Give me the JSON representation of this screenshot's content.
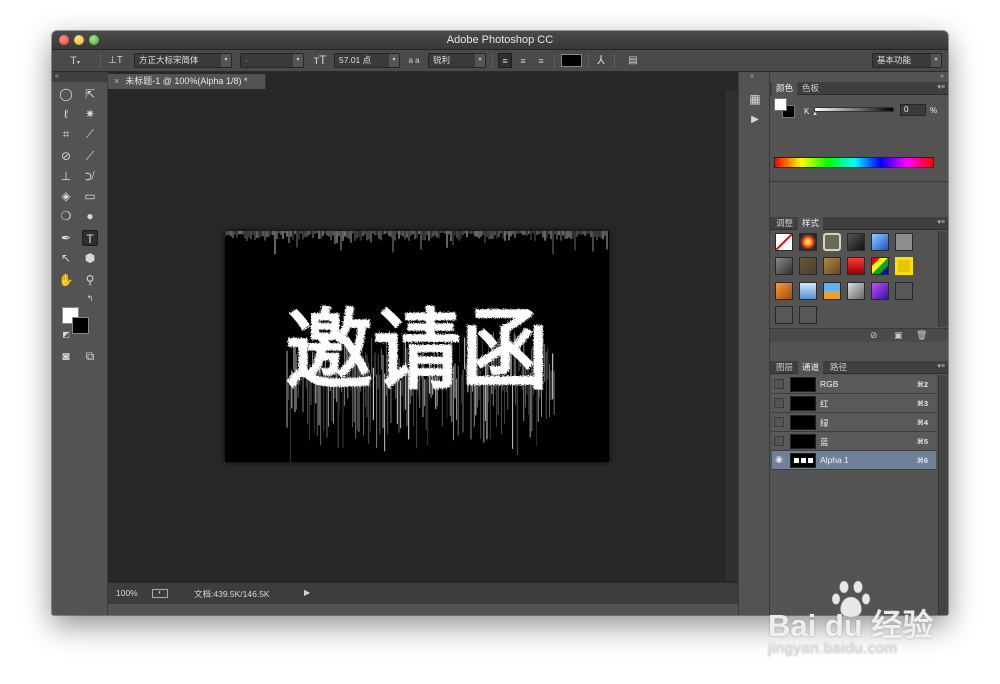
{
  "window": {
    "title": "Adobe Photoshop CC"
  },
  "options_bar": {
    "font_family": "方正大标宋简体",
    "font_style": "-",
    "font_size": "57.01 点",
    "aa_label": "a a",
    "antialias": "锐利",
    "workspace": "基本功能",
    "text_color": "#000000"
  },
  "document": {
    "tab_title": "未标题-1 @ 100%(Alpha 1/8) *",
    "zoom": "100%",
    "doc_size": "文档:439.5K/146.5K",
    "canvas_text": "邀请函"
  },
  "color_panel": {
    "tabs": [
      "颜色",
      "色板"
    ],
    "channel_label": "K",
    "value": "0",
    "unit": "%"
  },
  "styles_panel": {
    "tabs": [
      "调整",
      "样式"
    ]
  },
  "channels_panel": {
    "tabs": [
      "图层",
      "通道",
      "路径"
    ],
    "channels": [
      {
        "name": "RGB",
        "shortcut": "⌘2"
      },
      {
        "name": "红",
        "shortcut": "⌘3"
      },
      {
        "name": "绿",
        "shortcut": "⌘4"
      },
      {
        "name": "蓝",
        "shortcut": "⌘5"
      },
      {
        "name": "Alpha 1",
        "shortcut": "⌘6"
      }
    ]
  },
  "watermark": {
    "brand": "Bai du 经验",
    "url": "jingyan.baidu.com"
  },
  "icons": {
    "type_tool": "type-tool-icon",
    "orient": "text-orientation-icon",
    "marquee": "ellipse-marquee-icon",
    "move": "move-tool-icon",
    "eye": "eye-icon"
  }
}
